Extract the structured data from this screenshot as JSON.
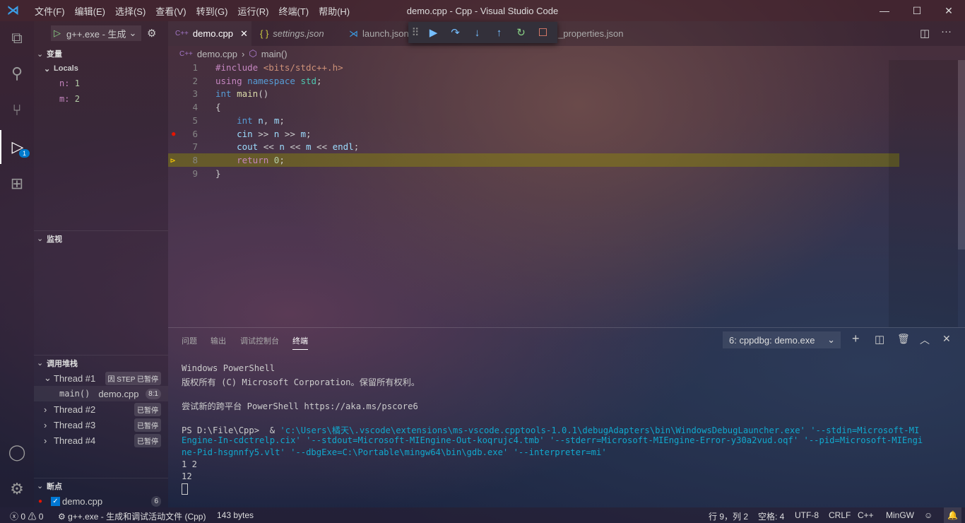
{
  "window": {
    "title": "demo.cpp - Cpp - Visual Studio Code",
    "menu": [
      "文件(F)",
      "编辑(E)",
      "选择(S)",
      "查看(V)",
      "转到(G)",
      "运行(R)",
      "终端(T)",
      "帮助(H)"
    ]
  },
  "activity": {
    "debug_badge": "1"
  },
  "debug": {
    "config": "g++.exe - 生成",
    "variables_title": "变量",
    "locals_label": "Locals",
    "locals": [
      {
        "name": "n:",
        "value": "1"
      },
      {
        "name": "m:",
        "value": "2"
      }
    ],
    "watch_title": "监视",
    "callstack_title": "调用堆栈",
    "threads": [
      {
        "name": "Thread #1",
        "status": "因 STEP 已暂停"
      },
      {
        "name": "Thread #2",
        "status": "已暂停"
      },
      {
        "name": "Thread #3",
        "status": "已暂停"
      },
      {
        "name": "Thread #4",
        "status": "已暂停"
      }
    ],
    "frame": {
      "fn": "main()",
      "file": "demo.cpp",
      "pos": "8:1"
    },
    "breakpoints_title": "断点",
    "breakpoint": {
      "file": "demo.cpp",
      "count": "6"
    }
  },
  "tabs": [
    {
      "label": "demo.cpp",
      "icon": "C++"
    },
    {
      "label": "settings.json",
      "icon": "{ }"
    },
    {
      "label": "launch.json"
    },
    {
      "label": "_properties.json"
    }
  ],
  "breadcrumb": {
    "file": "demo.cpp",
    "symbol": "main()",
    "file_icon": "C++"
  },
  "editor": {
    "line_numbers": [
      "1",
      "2",
      "3",
      "4",
      "5",
      "6",
      "7",
      "8",
      "9"
    ],
    "breakpoint_line": 6,
    "current_line": 8
  },
  "panel": {
    "tabs": [
      "问题",
      "输出",
      "调试控制台",
      "终端"
    ],
    "active_tab": "终端",
    "terminal_select": "6: cppdbg: demo.exe",
    "terminal": [
      "Windows PowerShell",
      "版权所有 (C) Microsoft Corporation。保留所有权利。",
      "",
      "尝试新的跨平台 PowerShell https://aka.ms/pscore6",
      "",
      "PS D:\\File\\Cpp>  & ",
      "'c:\\Users\\橘天\\.vscode\\extensions\\ms-vscode.cpptools-1.0.1\\debugAdapters\\bin\\WindowsDebugLauncher.exe' '--stdin=Microsoft-MI",
      "Engine-In-cdctrelp.cix' '--stdout=Microsoft-MIEngine-Out-koqrujc4.tmb' '--stderr=Microsoft-MIEngine-Error-y30a2vud.oqf' '--pid=Microsoft-MIEngi",
      "ne-Pid-hsgnnfy5.vlt' '--dbgExe=C:\\Portable\\mingw64\\bin\\gdb.exe' '--interpreter=mi'",
      "1 2",
      "12"
    ]
  },
  "status": {
    "errors": "0",
    "warnings": "0",
    "launch": "g++.exe - 生成和调试活动文件 (Cpp)",
    "size": "143 bytes",
    "position": "行 9，列 2",
    "spaces": "空格: 4",
    "encoding": "UTF-8",
    "eol": "CRLF",
    "language": "C++",
    "compiler": "MinGW"
  }
}
